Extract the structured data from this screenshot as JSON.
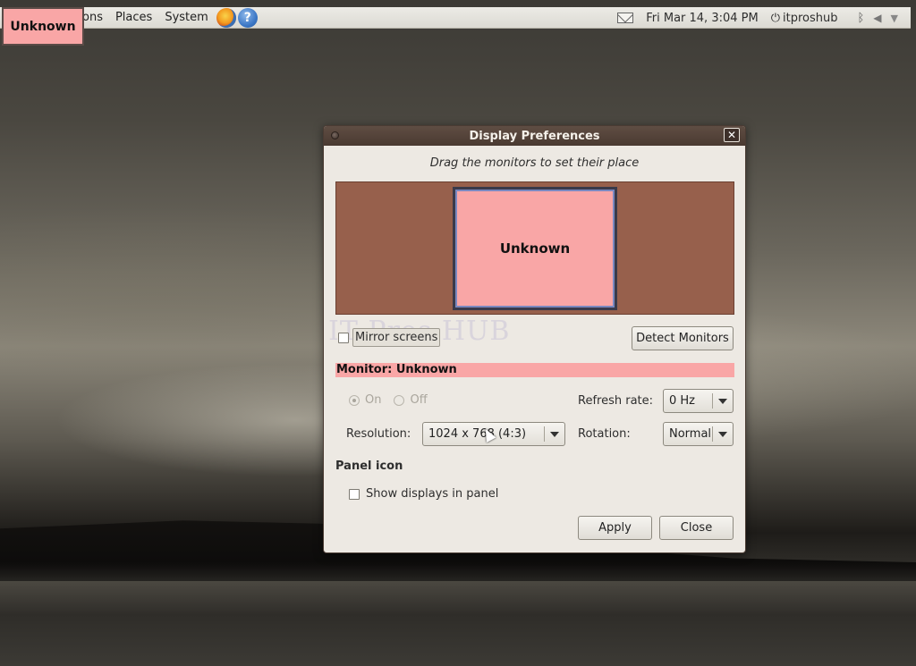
{
  "top_panel": {
    "menu_applications": "ons",
    "menu_places": "Places",
    "menu_system": "System",
    "clock": "Fri Mar 14,  3:04 PM",
    "user": "itproshub"
  },
  "overlay_label": "Unknown",
  "dialog": {
    "title": "Display Preferences",
    "hint": "Drag the monitors to set their place",
    "monitor_box_label": "Unknown",
    "watermark": "IT Pros HUB",
    "mirror_screens_label": "Mirror screens",
    "mirror_screens_checked": false,
    "detect_monitors_label": "Detect Monitors",
    "monitor_header": "Monitor: Unknown",
    "power": {
      "on_label": "On",
      "off_label": "Off",
      "selected": "On"
    },
    "refresh_rate": {
      "label": "Refresh rate:",
      "value": "0 Hz"
    },
    "resolution": {
      "label": "Resolution:",
      "value": "1024 x 768 (4:3)"
    },
    "rotation": {
      "label": "Rotation:",
      "value": "Normal"
    },
    "panel_icon_title": "Panel icon",
    "show_displays_label": "Show displays in panel",
    "show_displays_checked": false,
    "apply_label": "Apply",
    "close_label": "Close"
  },
  "colors": {
    "monitor_pink": "#f9a6a6",
    "arrange_bg": "#97604c",
    "titlebar": "#4a3a31",
    "dialog_bg": "#ede9e3"
  },
  "icons": {
    "firefox": "firefox-icon",
    "help": "help-icon",
    "mail": "mail-icon",
    "power": "power-icon",
    "bluetooth": "bluetooth-icon",
    "volume": "volume-icon",
    "network": "network-icon"
  }
}
